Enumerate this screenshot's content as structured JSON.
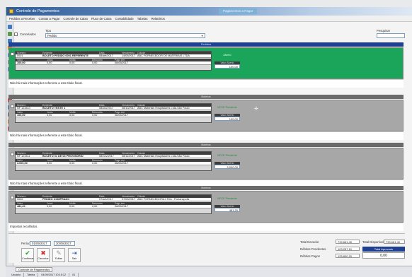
{
  "window": {
    "title": "Controle de Pagamentos",
    "center_tab": "Pagamentos a Pagar"
  },
  "menu": [
    "Pedidos a Receber",
    "Contas a Pagar",
    "Controle de Caixa",
    "Fluxo de Caixa",
    "Contabilidade",
    "Tabelas",
    "Relatórios"
  ],
  "filter": {
    "checkbox_label": "Cancelados",
    "tipo_label": "Tipo",
    "tipo_value": "Pedido",
    "search_label": "Pesquisar",
    "search_value": ""
  },
  "section_header": "Pedidos",
  "separator_label": "Boletos",
  "col_headers": {
    "row1": [
      "Número",
      "Emitente",
      "Data",
      "Vencimento",
      "Cidade"
    ],
    "row2": [
      "Valor",
      "Juros",
      "Multa",
      "Desconto",
      "Pago em"
    ]
  },
  "cards": [
    {
      "style": "green",
      "numero": "0001",
      "emitente": "BOLETO PEDIDO 0001 REFERENTE",
      "data": "08/set/2017",
      "vencimento": "14/09/2017",
      "cidade": "ABC FORNECEDOR DE MATERIAIS LTDA",
      "valor": "100,00",
      "juros": "0,00",
      "multa": "0,00",
      "desconto": "0,00",
      "pago_em": "06/09/2017",
      "side_top": "Aberto",
      "side_label": "Valor Aberto",
      "side_value": "100,00",
      "note": "Não há mais informações referente a este título fiscal."
    },
    {
      "style": "gray",
      "numero": "NF 123410",
      "emitente": "BOLETO TESTE 1",
      "data": "08/out/2017",
      "vencimento": "08/10/2017",
      "cidade": "ABC Materiais Hospitalares Ltda-São Paulo",
      "valor": "100,00",
      "juros": "0,00",
      "multa": "0,00",
      "desconto": "0,00",
      "pago_em": "06/09/2017",
      "side_top": "NFCE Pendente",
      "side_label": "Valor Aberto",
      "side_value": "100,00",
      "note": "Não há mais informações referente a este título fiscal."
    },
    {
      "style": "gray",
      "numero": "NF 123411",
      "emitente": "BOLETO 01 DE 03 PROVISÓRIO",
      "data": "08/nov/2017",
      "vencimento": "08/11/2017",
      "cidade": "ABC Materiais Hospitalares Ltda-São Paulo",
      "valor": "3.000,00",
      "juros": "0,00",
      "multa": "0,00",
      "desconto": "0,00",
      "pago_em": "06/09/2017",
      "side_top": "NFCE Pendente",
      "side_label": "Valor Aberto",
      "side_value": "3.000,00",
      "note": "Não há mais informações referente a este título fiscal."
    },
    {
      "style": "gray",
      "numero": "0002",
      "emitente": "PEDIDO COMPRADO",
      "data": "07/set/2017",
      "vencimento": "07/09/2017",
      "cidade": "ABC FORNECEDORA LTDA - Florianópolis",
      "valor": "481,20",
      "juros": "0,00",
      "multa": "0,00",
      "desconto": "0,00",
      "pago_em": "06/09/2017",
      "side_top": "NFCE Pendente",
      "side_label": "Valor Aberto",
      "side_value": "481,20",
      "note": "Impostos recolhidos."
    }
  ],
  "footer": {
    "periodo_label": "Período",
    "date_from": "01/09/2017",
    "date_to": "30/09/2017",
    "buttons": [
      {
        "label": "Confirmar",
        "icon": "✔"
      },
      {
        "label": "Cancelar",
        "icon": "✖"
      },
      {
        "label": "Editar",
        "icon": "✎"
      },
      {
        "label": "Sair",
        "icon": "⇥"
      }
    ],
    "totals": [
      {
        "label": "Total Devedor",
        "value": "739.661,40"
      },
      {
        "label": "Débitos Pendentes",
        "value": "103.257,10"
      },
      {
        "label": "Débitos Pagos",
        "value": "125.800,20"
      }
    ],
    "total_aberto_label": "Total Disponível",
    "total_aberto_value": "739.661,40",
    "total_aprovado_label": "Total Aprovado",
    "total_aprovado_value": "0,00"
  },
  "taskbar": {
    "button": "Controle de Pagamentos",
    "status": [
      "Usuário",
      "Tabela",
      "04/09/2017 10:15:12",
      "01"
    ]
  }
}
